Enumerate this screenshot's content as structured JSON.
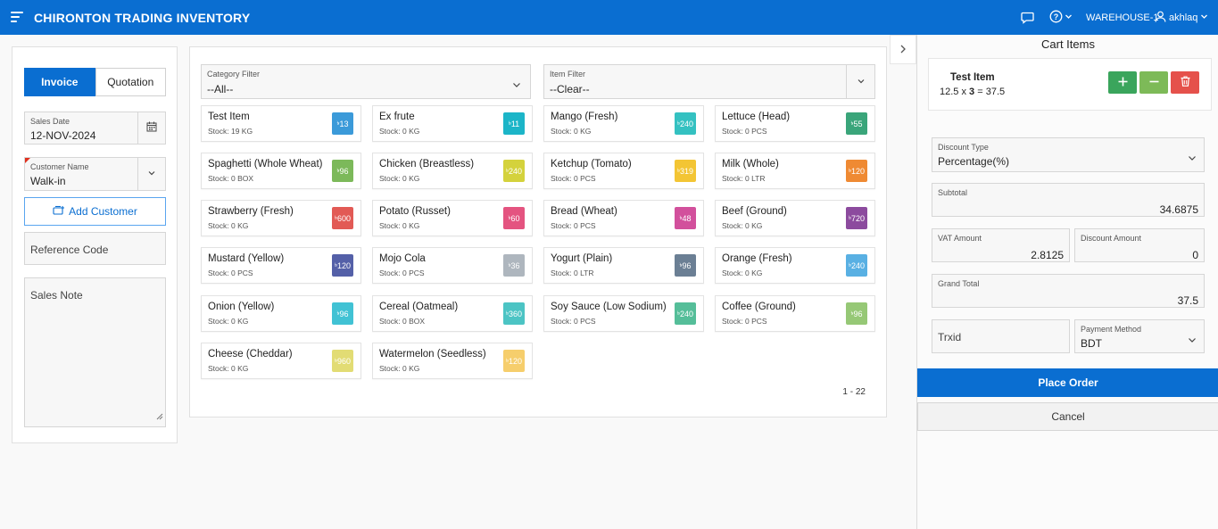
{
  "header": {
    "title": "CHIRONTON TRADING INVENTORY",
    "warehouse": "WAREHOUSE-1",
    "user": "akhlaq",
    "brand_color": "#0a6ed1"
  },
  "left": {
    "tabs": [
      "Invoice",
      "Quotation"
    ],
    "active_tab": "Invoice",
    "sales_date_label": "Sales Date",
    "sales_date_value": "12-NOV-2024",
    "customer_label": "Customer Name",
    "customer_value": "Walk-in",
    "add_customer": "Add Customer",
    "reference_placeholder": "Reference Code",
    "sales_note_placeholder": "Sales Note"
  },
  "filters": {
    "category_label": "Category Filter",
    "category_value": "--All--",
    "item_label": "Item Filter",
    "item_value": "--Clear--"
  },
  "currency_symbol": "৳",
  "items": [
    {
      "name": "Test Item",
      "stock": "Stock: 19 KG",
      "price": "13",
      "color": "#3b9ad9"
    },
    {
      "name": "Ex frute",
      "stock": "Stock: 0 KG",
      "price": "11",
      "color": "#1cb5c8"
    },
    {
      "name": "Mango (Fresh)",
      "stock": "Stock: 0 KG",
      "price": "240",
      "color": "#34c1c1"
    },
    {
      "name": "Lettuce (Head)",
      "stock": "Stock: 0 PCS",
      "price": "55",
      "color": "#3aa57a"
    },
    {
      "name": "Spaghetti (Whole Wheat)",
      "stock": "Stock: 0 BOX",
      "price": "96",
      "color": "#7cb95a"
    },
    {
      "name": "Chicken (Breastless)",
      "stock": "Stock: 0 KG",
      "price": "240",
      "color": "#d4d23c"
    },
    {
      "name": "Ketchup (Tomato)",
      "stock": "Stock: 0 PCS",
      "price": "319",
      "color": "#f3c534"
    },
    {
      "name": "Milk (Whole)",
      "stock": "Stock: 0 LTR",
      "price": "120",
      "color": "#ef8a33"
    },
    {
      "name": "Strawberry (Fresh)",
      "stock": "Stock: 0 KG",
      "price": "600",
      "color": "#e25a55"
    },
    {
      "name": "Potato (Russet)",
      "stock": "Stock: 0 KG",
      "price": "60",
      "color": "#e45480"
    },
    {
      "name": "Bread (Wheat)",
      "stock": "Stock: 0 PCS",
      "price": "48",
      "color": "#d2509c"
    },
    {
      "name": "Beef (Ground)",
      "stock": "Stock: 0 KG",
      "price": "720",
      "color": "#8c4b9e"
    },
    {
      "name": "Mustard (Yellow)",
      "stock": "Stock: 0 PCS",
      "price": "120",
      "color": "#5460a8"
    },
    {
      "name": "Mojo Cola",
      "stock": "Stock: 0 PCS",
      "price": "36",
      "color": "#aeb6be"
    },
    {
      "name": "Yogurt (Plain)",
      "stock": "Stock: 0 LTR",
      "price": "96",
      "color": "#6b7f94"
    },
    {
      "name": "Orange (Fresh)",
      "stock": "Stock: 0 KG",
      "price": "240",
      "color": "#59b0e3"
    },
    {
      "name": "Onion (Yellow)",
      "stock": "Stock: 0 KG",
      "price": "96",
      "color": "#41c2d4"
    },
    {
      "name": "Cereal (Oatmeal)",
      "stock": "Stock: 0 BOX",
      "price": "360",
      "color": "#4cc4c4"
    },
    {
      "name": "Soy Sauce (Low Sodium)",
      "stock": "Stock: 0 PCS",
      "price": "240",
      "color": "#55be99"
    },
    {
      "name": "Coffee (Ground)",
      "stock": "Stock: 0 PCS",
      "price": "96",
      "color": "#96c876"
    },
    {
      "name": "Cheese (Cheddar)",
      "stock": "Stock: 0 KG",
      "price": "960",
      "color": "#e2dc74"
    },
    {
      "name": "Watermelon (Seedless)",
      "stock": "Stock: 0 KG",
      "price": "120",
      "color": "#f6ce6c"
    }
  ],
  "pager": "1 - 22",
  "cart": {
    "title": "Cart Items",
    "item_name": "Test Item",
    "price": "12.5",
    "times": "x",
    "qty": "3",
    "equals": "=",
    "line_total": "37.5",
    "discount_type_label": "Discount Type",
    "discount_type_value": "Percentage(%)",
    "subtotal_label": "Subtotal",
    "subtotal_value": "34.6875",
    "vat_label": "VAT Amount",
    "vat_value": "2.8125",
    "discount_label": "Discount Amount",
    "discount_value": "0",
    "grand_total_label": "Grand Total",
    "grand_total_value": "37.5",
    "trxid_placeholder": "Trxid",
    "payment_label": "Payment Method",
    "payment_value": "BDT",
    "place_order": "Place Order",
    "cancel": "Cancel"
  }
}
